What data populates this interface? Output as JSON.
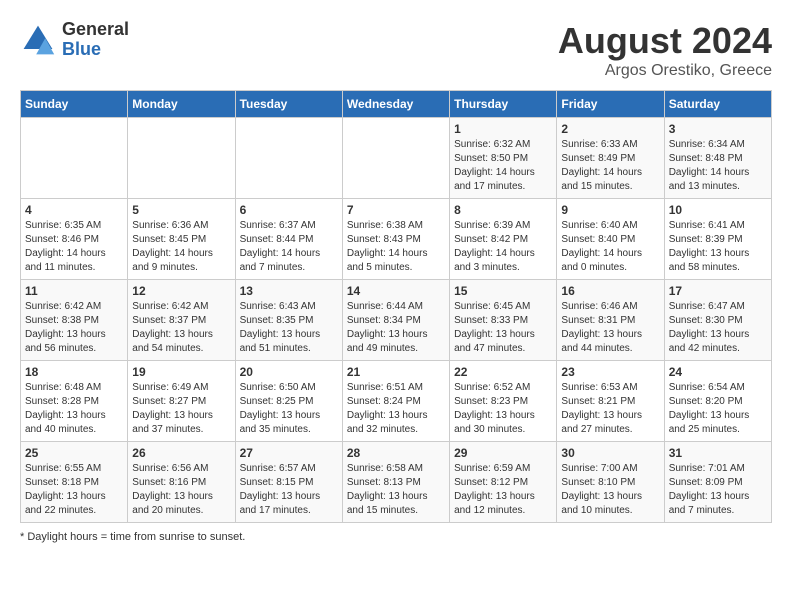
{
  "header": {
    "logo_general": "General",
    "logo_blue": "Blue",
    "main_title": "August 2024",
    "subtitle": "Argos Orestiko, Greece"
  },
  "days_of_week": [
    "Sunday",
    "Monday",
    "Tuesday",
    "Wednesday",
    "Thursday",
    "Friday",
    "Saturday"
  ],
  "footer": {
    "note": "Daylight hours"
  },
  "weeks": [
    [
      {
        "day": "",
        "sunrise": "",
        "sunset": "",
        "daylight": ""
      },
      {
        "day": "",
        "sunrise": "",
        "sunset": "",
        "daylight": ""
      },
      {
        "day": "",
        "sunrise": "",
        "sunset": "",
        "daylight": ""
      },
      {
        "day": "",
        "sunrise": "",
        "sunset": "",
        "daylight": ""
      },
      {
        "day": "1",
        "sunrise": "Sunrise: 6:32 AM",
        "sunset": "Sunset: 8:50 PM",
        "daylight": "Daylight: 14 hours and 17 minutes."
      },
      {
        "day": "2",
        "sunrise": "Sunrise: 6:33 AM",
        "sunset": "Sunset: 8:49 PM",
        "daylight": "Daylight: 14 hours and 15 minutes."
      },
      {
        "day": "3",
        "sunrise": "Sunrise: 6:34 AM",
        "sunset": "Sunset: 8:48 PM",
        "daylight": "Daylight: 14 hours and 13 minutes."
      }
    ],
    [
      {
        "day": "4",
        "sunrise": "Sunrise: 6:35 AM",
        "sunset": "Sunset: 8:46 PM",
        "daylight": "Daylight: 14 hours and 11 minutes."
      },
      {
        "day": "5",
        "sunrise": "Sunrise: 6:36 AM",
        "sunset": "Sunset: 8:45 PM",
        "daylight": "Daylight: 14 hours and 9 minutes."
      },
      {
        "day": "6",
        "sunrise": "Sunrise: 6:37 AM",
        "sunset": "Sunset: 8:44 PM",
        "daylight": "Daylight: 14 hours and 7 minutes."
      },
      {
        "day": "7",
        "sunrise": "Sunrise: 6:38 AM",
        "sunset": "Sunset: 8:43 PM",
        "daylight": "Daylight: 14 hours and 5 minutes."
      },
      {
        "day": "8",
        "sunrise": "Sunrise: 6:39 AM",
        "sunset": "Sunset: 8:42 PM",
        "daylight": "Daylight: 14 hours and 3 minutes."
      },
      {
        "day": "9",
        "sunrise": "Sunrise: 6:40 AM",
        "sunset": "Sunset: 8:40 PM",
        "daylight": "Daylight: 14 hours and 0 minutes."
      },
      {
        "day": "10",
        "sunrise": "Sunrise: 6:41 AM",
        "sunset": "Sunset: 8:39 PM",
        "daylight": "Daylight: 13 hours and 58 minutes."
      }
    ],
    [
      {
        "day": "11",
        "sunrise": "Sunrise: 6:42 AM",
        "sunset": "Sunset: 8:38 PM",
        "daylight": "Daylight: 13 hours and 56 minutes."
      },
      {
        "day": "12",
        "sunrise": "Sunrise: 6:42 AM",
        "sunset": "Sunset: 8:37 PM",
        "daylight": "Daylight: 13 hours and 54 minutes."
      },
      {
        "day": "13",
        "sunrise": "Sunrise: 6:43 AM",
        "sunset": "Sunset: 8:35 PM",
        "daylight": "Daylight: 13 hours and 51 minutes."
      },
      {
        "day": "14",
        "sunrise": "Sunrise: 6:44 AM",
        "sunset": "Sunset: 8:34 PM",
        "daylight": "Daylight: 13 hours and 49 minutes."
      },
      {
        "day": "15",
        "sunrise": "Sunrise: 6:45 AM",
        "sunset": "Sunset: 8:33 PM",
        "daylight": "Daylight: 13 hours and 47 minutes."
      },
      {
        "day": "16",
        "sunrise": "Sunrise: 6:46 AM",
        "sunset": "Sunset: 8:31 PM",
        "daylight": "Daylight: 13 hours and 44 minutes."
      },
      {
        "day": "17",
        "sunrise": "Sunrise: 6:47 AM",
        "sunset": "Sunset: 8:30 PM",
        "daylight": "Daylight: 13 hours and 42 minutes."
      }
    ],
    [
      {
        "day": "18",
        "sunrise": "Sunrise: 6:48 AM",
        "sunset": "Sunset: 8:28 PM",
        "daylight": "Daylight: 13 hours and 40 minutes."
      },
      {
        "day": "19",
        "sunrise": "Sunrise: 6:49 AM",
        "sunset": "Sunset: 8:27 PM",
        "daylight": "Daylight: 13 hours and 37 minutes."
      },
      {
        "day": "20",
        "sunrise": "Sunrise: 6:50 AM",
        "sunset": "Sunset: 8:25 PM",
        "daylight": "Daylight: 13 hours and 35 minutes."
      },
      {
        "day": "21",
        "sunrise": "Sunrise: 6:51 AM",
        "sunset": "Sunset: 8:24 PM",
        "daylight": "Daylight: 13 hours and 32 minutes."
      },
      {
        "day": "22",
        "sunrise": "Sunrise: 6:52 AM",
        "sunset": "Sunset: 8:23 PM",
        "daylight": "Daylight: 13 hours and 30 minutes."
      },
      {
        "day": "23",
        "sunrise": "Sunrise: 6:53 AM",
        "sunset": "Sunset: 8:21 PM",
        "daylight": "Daylight: 13 hours and 27 minutes."
      },
      {
        "day": "24",
        "sunrise": "Sunrise: 6:54 AM",
        "sunset": "Sunset: 8:20 PM",
        "daylight": "Daylight: 13 hours and 25 minutes."
      }
    ],
    [
      {
        "day": "25",
        "sunrise": "Sunrise: 6:55 AM",
        "sunset": "Sunset: 8:18 PM",
        "daylight": "Daylight: 13 hours and 22 minutes."
      },
      {
        "day": "26",
        "sunrise": "Sunrise: 6:56 AM",
        "sunset": "Sunset: 8:16 PM",
        "daylight": "Daylight: 13 hours and 20 minutes."
      },
      {
        "day": "27",
        "sunrise": "Sunrise: 6:57 AM",
        "sunset": "Sunset: 8:15 PM",
        "daylight": "Daylight: 13 hours and 17 minutes."
      },
      {
        "day": "28",
        "sunrise": "Sunrise: 6:58 AM",
        "sunset": "Sunset: 8:13 PM",
        "daylight": "Daylight: 13 hours and 15 minutes."
      },
      {
        "day": "29",
        "sunrise": "Sunrise: 6:59 AM",
        "sunset": "Sunset: 8:12 PM",
        "daylight": "Daylight: 13 hours and 12 minutes."
      },
      {
        "day": "30",
        "sunrise": "Sunrise: 7:00 AM",
        "sunset": "Sunset: 8:10 PM",
        "daylight": "Daylight: 13 hours and 10 minutes."
      },
      {
        "day": "31",
        "sunrise": "Sunrise: 7:01 AM",
        "sunset": "Sunset: 8:09 PM",
        "daylight": "Daylight: 13 hours and 7 minutes."
      }
    ]
  ]
}
